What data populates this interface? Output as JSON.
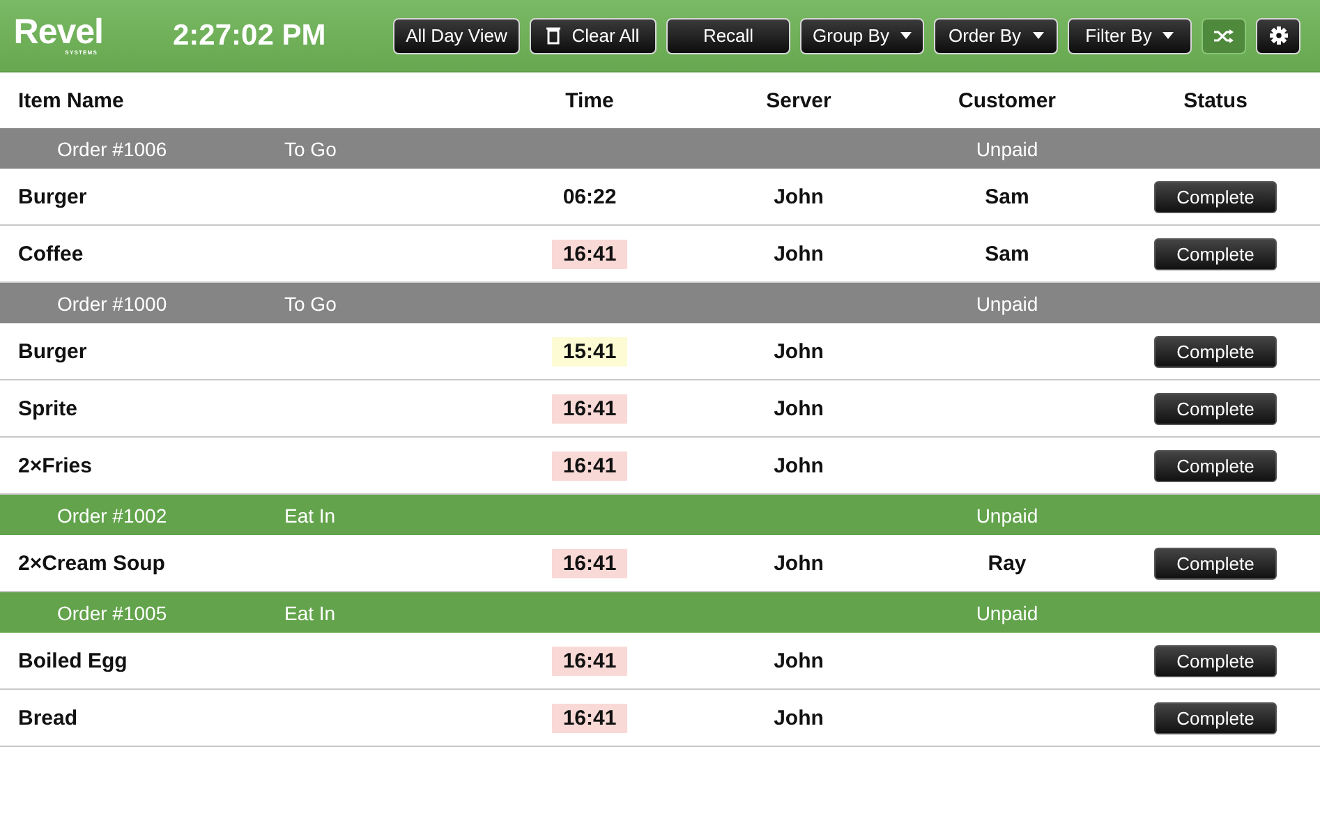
{
  "header": {
    "logo": "Revel",
    "logo_sub": "SYSTEMS",
    "clock": "2:27:02 PM",
    "buttons": [
      {
        "label": "All Day View",
        "kind": "plain"
      },
      {
        "label": "Clear All",
        "kind": "trash"
      },
      {
        "label": "Recall",
        "kind": "wide"
      },
      {
        "label": "Group By",
        "kind": "dropdown"
      },
      {
        "label": "Order By",
        "kind": "dropdown"
      },
      {
        "label": "Filter By",
        "kind": "dropdown"
      }
    ],
    "shuffle_on": true
  },
  "table": {
    "columns": [
      "Item Name",
      "Time",
      "Server",
      "Customer",
      "Status"
    ],
    "orders": [
      {
        "title": "Order #1006",
        "type": "To Go",
        "payment": "Unpaid",
        "color": "#858585",
        "items": [
          {
            "name": "Burger",
            "time": "06:22",
            "server": "John",
            "customer": "Sam",
            "action": "Complete"
          },
          {
            "name": "Coffee",
            "time": "16:41",
            "color": "#f9d9d6",
            "server": "John",
            "customer": "Sam",
            "action": "Complete"
          }
        ]
      },
      {
        "title": "Order #1000",
        "type": "To Go",
        "payment": "Unpaid",
        "color": "#858585",
        "items": [
          {
            "name": "Burger",
            "time": "15:41",
            "color": "#fdfbd3",
            "server": "John",
            "action": "Complete"
          },
          {
            "name": "Sprite",
            "time": "16:41",
            "color": "#f9d9d6",
            "server": "John",
            "action": "Complete"
          },
          {
            "name": "2×Fries",
            "time": "16:41",
            "color": "#f9d9d6",
            "server": "John",
            "action": "Complete"
          }
        ]
      },
      {
        "title": "Order #1002",
        "type": "Eat In",
        "payment": "Unpaid",
        "color": "#62a34b",
        "items": [
          {
            "name": "2×Cream Soup",
            "time": "16:41",
            "color": "#f9d9d6",
            "server": "John",
            "customer": "Ray",
            "action": "Complete"
          }
        ]
      },
      {
        "title": "Order #1005",
        "type": "Eat In",
        "payment": "Unpaid",
        "color": "#62a34b",
        "items": [
          {
            "name": "Boiled Egg",
            "time": "16:41",
            "color": "#f9d9d6",
            "server": "John",
            "action": "Complete"
          },
          {
            "name": "Bread",
            "time": "16:41",
            "color": "#f9d9d6",
            "server": "John",
            "action": "Complete"
          }
        ]
      }
    ]
  }
}
